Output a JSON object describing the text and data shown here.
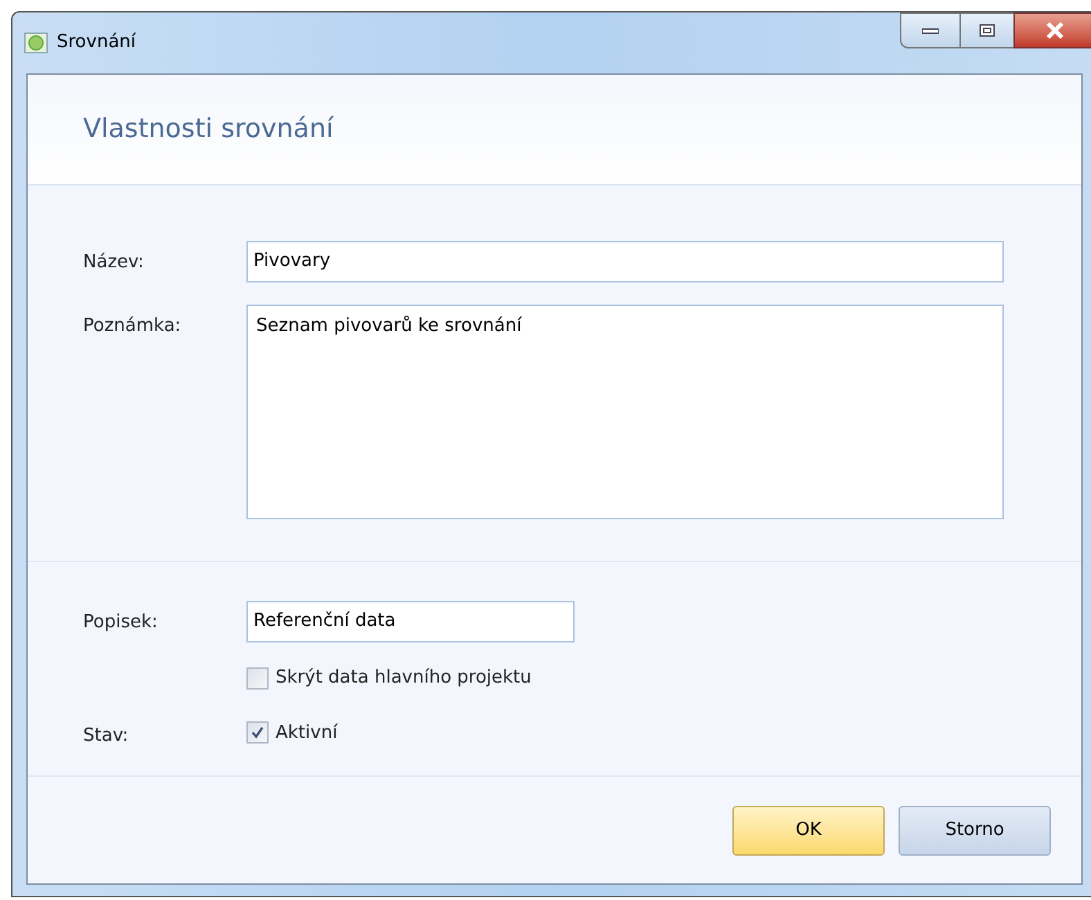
{
  "window": {
    "title": "Srovnání"
  },
  "header": {
    "title": "Vlastnosti srovnání"
  },
  "fields": [
    {
      "kind": "text",
      "label": "Název:",
      "value": "Pivovary"
    },
    {
      "kind": "textarea",
      "label": "Poznámka:",
      "value": "Seznam pivovarů ke srovnání"
    },
    {
      "kind": "short",
      "label": "Popisek:",
      "value": "Referenční data"
    },
    {
      "kind": "checkbox",
      "text": "Skrýt data hlavního projektu",
      "checked": false
    },
    {
      "kind": "checkbox",
      "label": "Stav:",
      "text": "Aktivní",
      "checked": true
    }
  ],
  "buttons": [
    {
      "label": "OK",
      "default": true
    },
    {
      "label": "Storno",
      "default": false
    }
  ]
}
